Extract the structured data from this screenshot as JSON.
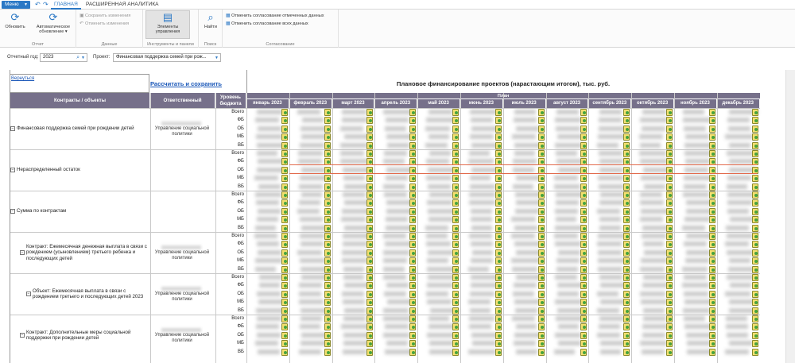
{
  "topbar": {
    "menu_label": "Меню",
    "tabs": [
      "ГЛАВНАЯ",
      "РАСШИРЕННАЯ АНАЛИТИКА"
    ]
  },
  "ribbon": {
    "refresh_label": "Обновить",
    "auto_refresh_label": "Автоматическое обновление",
    "report_group": "Отчет",
    "save_changes": "Сохранить изменения",
    "cancel_changes": "Отменить изменения",
    "data_group": "Данные",
    "controls_label": "Элементы управления",
    "tools_group": "Инструменты и панели",
    "find_label": "Найти",
    "search_group": "Поиск",
    "cancel_marked": "Отменить согласование отмеченных данных",
    "cancel_all": "Отменить согласование всех данных",
    "approval_group": "Согласование"
  },
  "filters": {
    "year_label": "Отчетный год:",
    "year_value": "2023",
    "project_label": "Проект:",
    "project_value": "Финансовая поддержка семей при рож..."
  },
  "report": {
    "back_link": "Вернуться",
    "calc_link": "Рассчитать и сохранить",
    "title": "Плановое финансирование проектов (нарастающим итогом), тыс. руб.",
    "col_contracts": "Контракты / объекты",
    "col_responsible": "Ответственный",
    "col_level": "Уровень бюджета",
    "plan_header": "План",
    "months": [
      "январь 2023",
      "февраль 2023",
      "март 2023",
      "апрель 2023",
      "май 2023",
      "июнь 2023",
      "июль 2023",
      "август 2023",
      "сентябрь 2023",
      "октябрь 2023",
      "ноябрь 2023",
      "декабрь 2023"
    ],
    "levels": [
      "Всего",
      "ФБ",
      "ОБ",
      "МБ",
      "ВБ"
    ],
    "groups": [
      {
        "label": "Финансовая поддержка семей при рождении детей",
        "responsible": "Управление социальной политики"
      },
      {
        "label": "Нераспределенный остаток",
        "responsible": ""
      },
      {
        "label": "Сумма по контрактам",
        "responsible": ""
      },
      {
        "label": "Контракт: Ежемесячная денежная выплата в связи с рождением (усыновлением) третьего ребенка и последующих детей",
        "responsible": "Управление социальной политики"
      },
      {
        "label": "Объект: Ежемесячная выплата в связи с рождением третьего и последующих детей 2023",
        "responsible": "Управление социальной политики"
      },
      {
        "label": "Контракт: Дополнительные меры социальной поддержки при рождении детей",
        "responsible": "Управление социальной политики"
      }
    ]
  }
}
